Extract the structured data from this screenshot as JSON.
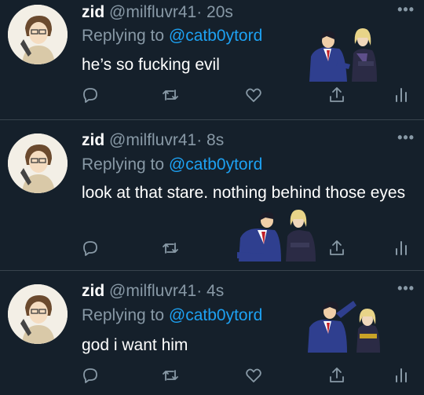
{
  "tweets": [
    {
      "name": "zid",
      "handle": "@milfluvr41",
      "time": "· 20s",
      "replying_prefix": "Replying to",
      "replying_to": "@catb0ytord",
      "text": "he’s so fucking evil",
      "more": "•••"
    },
    {
      "name": "zid",
      "handle": "@milfluvr41",
      "time": "· 8s",
      "replying_prefix": "Replying to",
      "replying_to": "@catb0ytord",
      "text": "look at that stare. nothing behind those eyes",
      "more": "•••"
    },
    {
      "name": "zid",
      "handle": "@milfluvr41",
      "time": "· 4s",
      "replying_prefix": "Replying to",
      "replying_to": "@catb0ytord",
      "text": "god i want him",
      "more": "•••"
    }
  ],
  "icons": [
    "reply-icon",
    "retweet-icon",
    "like-icon",
    "share-icon",
    "analytics-icon"
  ],
  "colors": {
    "background": "#15202b",
    "muted": "#8899a6",
    "accent": "#1da1f2",
    "divider": "#38444d"
  }
}
